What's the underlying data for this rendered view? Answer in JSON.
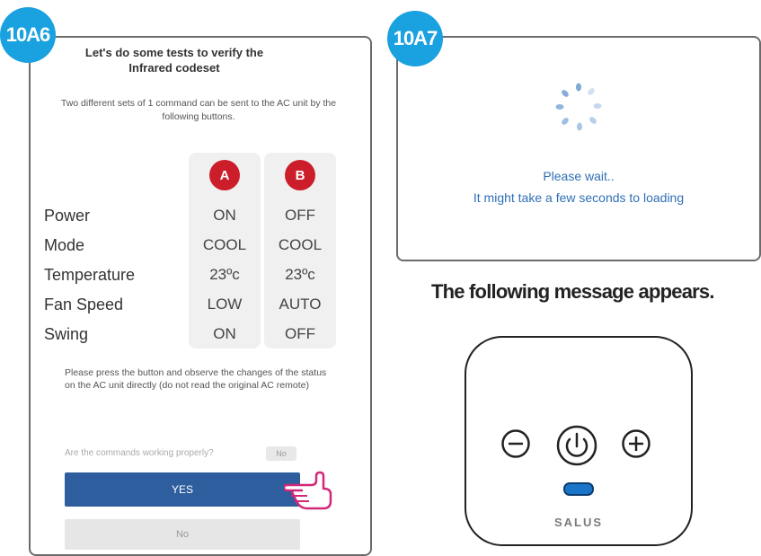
{
  "steps": {
    "left": "10A6",
    "right": "10A7"
  },
  "test_screen": {
    "title": "Let's do some tests to verify the Infrared codeset",
    "description": "Two different sets of 1 command can be sent to the AC unit by the following buttons.",
    "columns": [
      "A",
      "B"
    ],
    "rows": [
      {
        "label": "Power",
        "a": "ON",
        "b": "OFF"
      },
      {
        "label": "Mode",
        "a": "COOL",
        "b": "COOL"
      },
      {
        "label": "Temperature",
        "a": "23ºc",
        "b": "23ºc"
      },
      {
        "label": "Fan Speed",
        "a": "LOW",
        "b": "AUTO"
      },
      {
        "label": "Swing",
        "a": "ON",
        "b": "OFF"
      }
    ],
    "note": "Please press the button and observe the changes of the status on the AC unit directly (do not read the original AC remote)",
    "question": "Are the commands working properly?",
    "question_chip": "No",
    "yes_label": "YES",
    "no_label": "No"
  },
  "wait_screen": {
    "line1": "Please wait..",
    "line2": "It might take a few seconds to loading"
  },
  "message_heading": "The following message appears.",
  "device": {
    "brand": "SALUS",
    "icons": [
      "minus-icon",
      "power-icon",
      "plus-icon"
    ],
    "led_color": "#1a75c9"
  },
  "colors": {
    "badge": "#1aa1e0",
    "circle_ab": "#cc1e2a",
    "yes_button": "#2e5e9e",
    "wait_text": "#2f6fb5"
  }
}
